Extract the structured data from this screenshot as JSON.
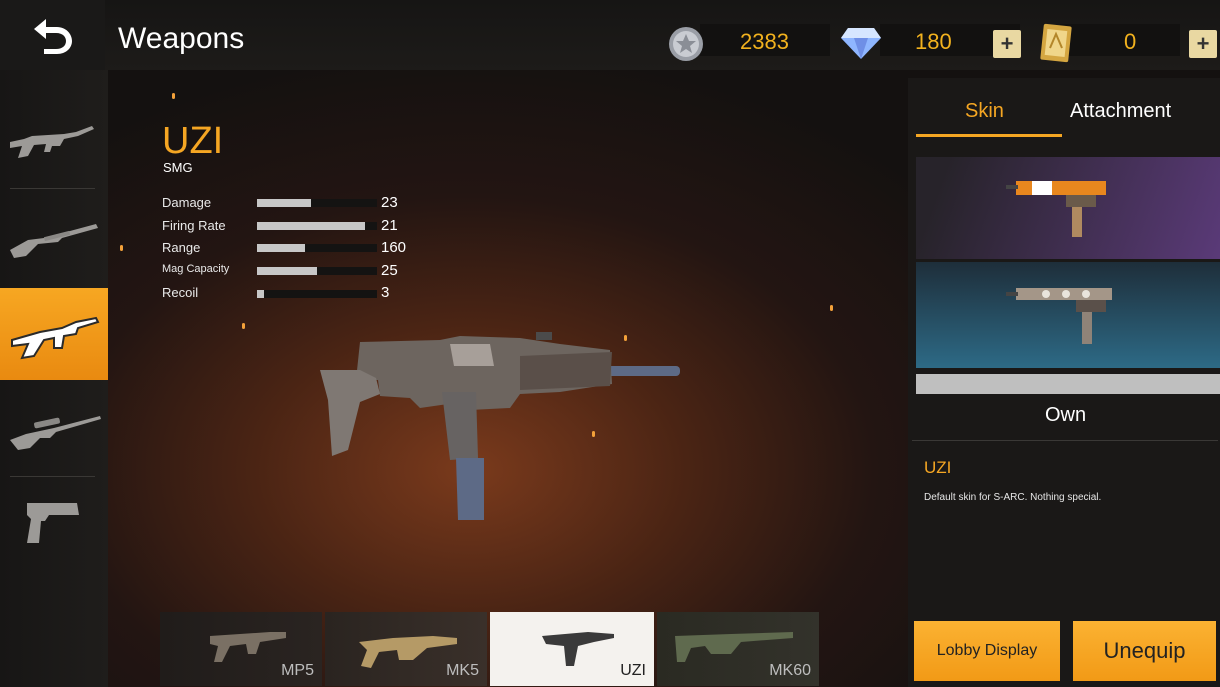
{
  "header": {
    "title": "Weapons",
    "back_icon": "back-arrow-icon",
    "coins": {
      "icon": "coin-icon",
      "value": "2383"
    },
    "diamonds": {
      "icon": "diamond-icon",
      "value": "180",
      "plus": "+"
    },
    "vouchers": {
      "icon": "voucher-icon",
      "value": "0",
      "plus": "+"
    }
  },
  "categories": [
    {
      "icon": "assault-rifle-icon",
      "active": false
    },
    {
      "icon": "shotgun-icon",
      "active": false
    },
    {
      "icon": "smg-icon",
      "active": true
    },
    {
      "icon": "sniper-rifle-icon",
      "active": false
    },
    {
      "icon": "pistol-icon",
      "active": false
    }
  ],
  "weapon": {
    "name": "UZI",
    "type": "SMG",
    "stats": [
      {
        "label": "Damage",
        "value": "23",
        "fill": 0.45
      },
      {
        "label": "Firing Rate",
        "value": "21",
        "fill": 0.9
      },
      {
        "label": "Range",
        "value": "160",
        "fill": 0.4
      },
      {
        "label": "Mag Capacity",
        "value": "25",
        "fill": 0.5
      },
      {
        "label": "Recoil",
        "value": "3",
        "fill": 0.06
      }
    ]
  },
  "weapon_list": [
    {
      "label": "MP5",
      "selected": false
    },
    {
      "label": "MK5",
      "selected": false
    },
    {
      "label": "UZI",
      "selected": true
    },
    {
      "label": "MK60",
      "selected": false
    }
  ],
  "panel": {
    "tabs": [
      {
        "label": "Skin",
        "active": true
      },
      {
        "label": "Attachment",
        "active": false
      }
    ],
    "own_label": "Own",
    "skin_name": "UZI",
    "skin_desc": "Default skin for S-ARC. Nothing special.",
    "buttons": {
      "lobby_display": "Lobby Display",
      "unequip": "Unequip"
    }
  },
  "colors": {
    "accent": "#f5a623",
    "active_tab_underline": "#f5a623",
    "button": "#f9a826"
  }
}
